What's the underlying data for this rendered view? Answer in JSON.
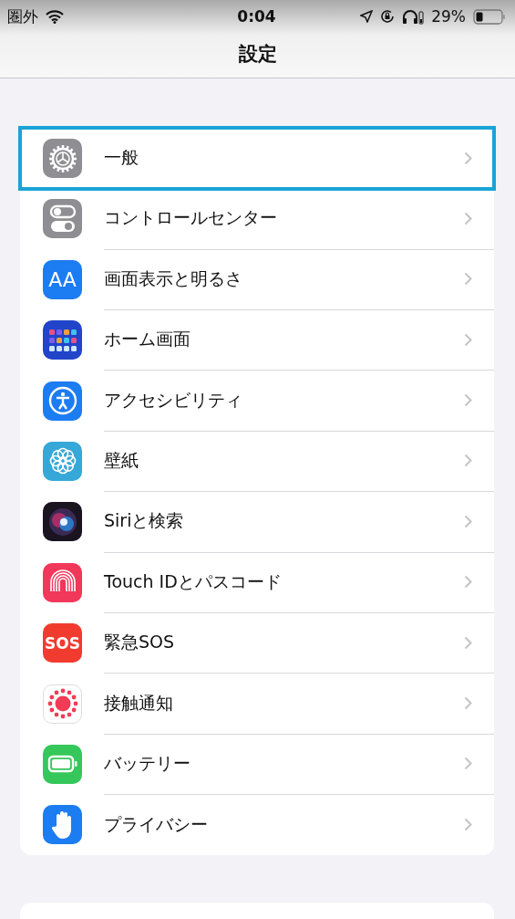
{
  "status_bar": {
    "carrier": "圏外",
    "time": "0:04",
    "battery_percent": "29%"
  },
  "nav_bar": {
    "title": "設定"
  },
  "settings": [
    {
      "label": "一般",
      "kind": "gear",
      "selected": true
    },
    {
      "label": "コントロールセンター",
      "kind": "toggles",
      "selected": false
    },
    {
      "label": "画面表示と明るさ",
      "kind": "text-size",
      "icon_text": "AA",
      "selected": false
    },
    {
      "label": "ホーム画面",
      "kind": "home-grid",
      "selected": false
    },
    {
      "label": "アクセシビリティ",
      "kind": "accessibility",
      "selected": false
    },
    {
      "label": "壁紙",
      "kind": "flower",
      "selected": false
    },
    {
      "label": "Siriと検索",
      "kind": "siri",
      "selected": false
    },
    {
      "label": "Touch IDとパスコード",
      "kind": "fingerprint",
      "selected": false
    },
    {
      "label": "緊急SOS",
      "kind": "sos",
      "icon_text": "SOS",
      "selected": false
    },
    {
      "label": "接触通知",
      "kind": "exposure",
      "selected": false
    },
    {
      "label": "バッテリー",
      "kind": "battery",
      "selected": false
    },
    {
      "label": "プライバシー",
      "kind": "hand",
      "selected": false
    }
  ]
}
